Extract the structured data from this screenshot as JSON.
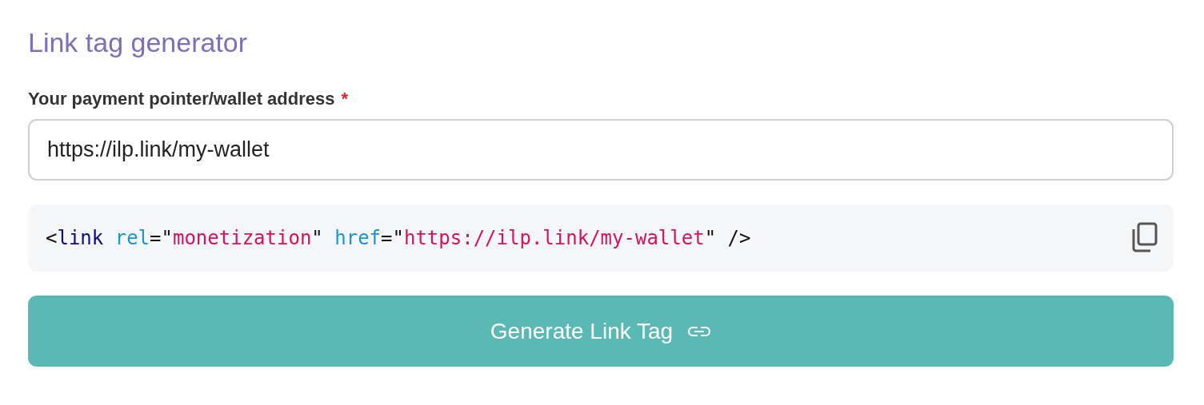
{
  "title": "Link tag generator",
  "field": {
    "label": "Your payment pointer/wallet address",
    "required_mark": "*",
    "value": "https://ilp.link/my-wallet"
  },
  "code": {
    "tokens": [
      {
        "kind": "punct",
        "text": "<"
      },
      {
        "kind": "tag",
        "text": "link"
      },
      {
        "kind": "attr",
        "text": " rel"
      },
      {
        "kind": "punct",
        "text": "=\""
      },
      {
        "kind": "string",
        "text": "monetization"
      },
      {
        "kind": "punct",
        "text": "\" "
      },
      {
        "kind": "attr",
        "text": "href"
      },
      {
        "kind": "punct",
        "text": "=\""
      },
      {
        "kind": "string",
        "text": "https://ilp.link/my-wallet"
      },
      {
        "kind": "punct",
        "text": "\" />"
      }
    ]
  },
  "button": {
    "label": "Generate Link Tag"
  }
}
